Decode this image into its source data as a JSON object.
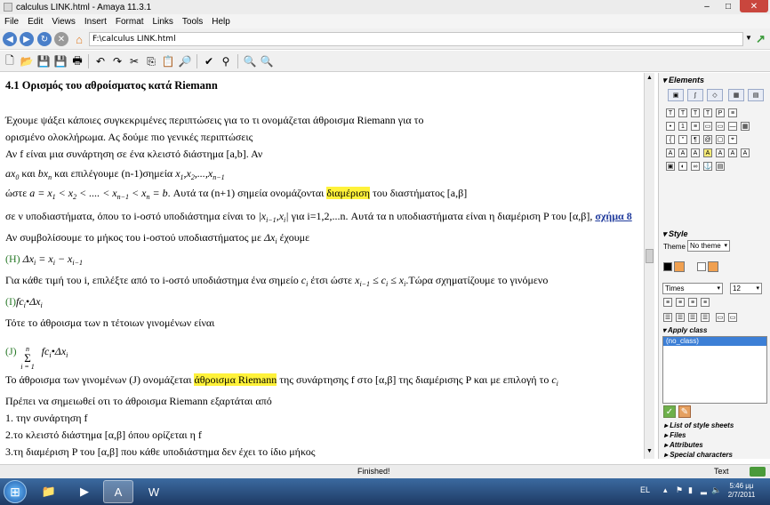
{
  "window": {
    "title": "calculus LINK.html - Amaya 11.3.1",
    "minimize": "–",
    "maximize": "□",
    "close": "✕"
  },
  "menu": [
    "File",
    "Edit",
    "Views",
    "Insert",
    "Format",
    "Links",
    "Tools",
    "Help"
  ],
  "address": {
    "url": "F:\\calculus LINK.html"
  },
  "document": {
    "heading": "4.1 Ορισμός του αθροίσματος κατά Riemann",
    "p1a": "Έχουμε ψάξει κάποιες συγκεκριμένες περιπτώσεις για το τι ονομάζεται άθροισμα Riemann για το",
    "p1b": "ορισμένο ολοκλήρωμα. Ας δούμε πιο γενικές περιπτώσεις",
    "p2": "Αν f είναι μια συνάρτηση σε ένα κλειστό διάστημα [a,b]. Αν",
    "p3_and": "και",
    "p3_rest": "και επιλέγουμε (n-1)σημεία",
    "p4_pre": "ώστε",
    "p4_post": ". Αυτά τα (n+1) σημεία ονομάζονται",
    "p4_hl": "διαμέριση",
    "p4_end": "του διαστήματος [a,β]",
    "p5_pre": "σε ν υποδιαστήματα, όπου το i-οστό υποδιάστημα είναι το",
    "p5_mid": "για i=1,2,...n. Αυτά τα n υποδιαστήματα είναι η διαμέριση P του [α,β],",
    "p5_link": "σχήμα 8",
    "p6": "Αν συμβολίσουμε το μήκος του i-οστού υποδιαστήματος με",
    "p6_end": "έχουμε",
    "eqH": "(H)",
    "p7_pre": "Για κάθε τιμή του i, επιλέξτε από το i-οστό υποδιάστημα ένα σημείο",
    "p7_mid": "έτσι ώστε",
    "p7_end": ".Τώρα σχηματίζουμε το γινόμενο",
    "eqI": "(I)",
    "p8": "Τότε το άθροισμα των n τέτοιων γινομένων είναι",
    "eqJ": "(J)",
    "p9_pre": "Το άθροισμα των γινομένων (J) ονομάζεται",
    "p9_hl": "άθροισμα Riemann",
    "p9_post": "της συνάρτησης f στο [α,β] της διαμέρισης P και με επιλογή το",
    "p10": "Πρέπει να σημειωθεί οτι το άθροισμα Riemann εξαρτάται από",
    "li1": "1. την συνάρτηση f",
    "li2": "2.το κλειστό διάστημα [α,β] όπου ορίζεται η f",
    "li3": "3.τη διαμέριση P του [α,β] που κάθε υποδιάστημα δεν έχει το ίδιο μήκος"
  },
  "panel": {
    "elements": "Elements",
    "style": "Style",
    "theme_label": "Theme",
    "theme_value": "No theme",
    "font_family": "Times",
    "font_size": "12",
    "apply_class": "Apply class",
    "class_item": "(no_class)",
    "links": [
      "List of style sheets",
      "Files",
      "Attributes",
      "Special characters"
    ]
  },
  "status": {
    "message": "Finished!",
    "mode": "Text"
  },
  "taskbar": {
    "lang": "EL",
    "time": "5:46 μμ",
    "date": "2/7/2011"
  }
}
